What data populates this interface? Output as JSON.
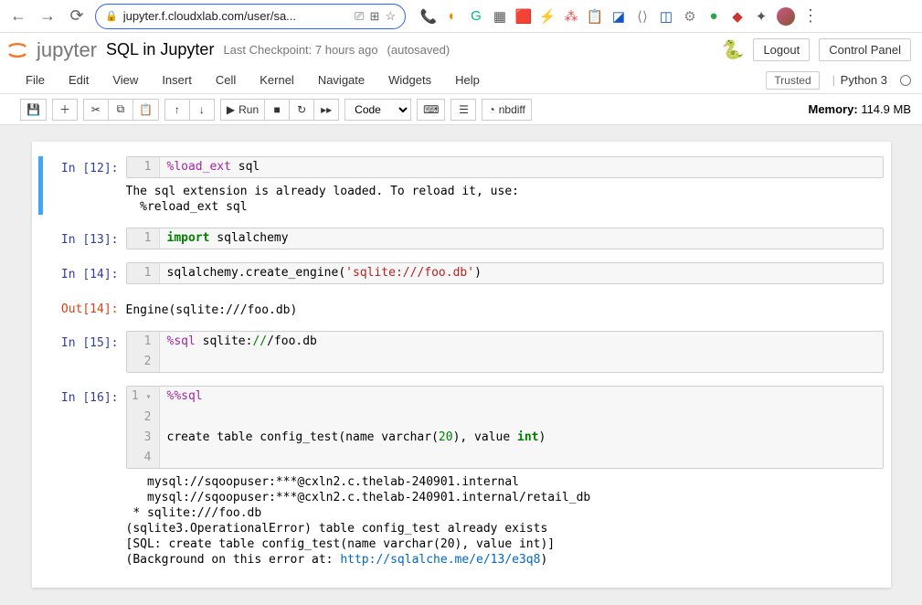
{
  "browser": {
    "url": "jupyter.f.cloudxlab.com/user/sa..."
  },
  "header": {
    "logo_text": "jupyter",
    "title": "SQL in Jupyter",
    "checkpoint": "Last Checkpoint: 7 hours ago",
    "autosaved": "(autosaved)",
    "logout": "Logout",
    "control_panel": "Control Panel"
  },
  "menu": {
    "items": [
      "File",
      "Edit",
      "View",
      "Insert",
      "Cell",
      "Kernel",
      "Navigate",
      "Widgets",
      "Help"
    ],
    "trusted": "Trusted",
    "kernel": "Python 3"
  },
  "toolbar": {
    "run": "Run",
    "cell_type": "Code",
    "nbdiff": "nbdiff",
    "memory_label": "Memory:",
    "memory_value": "114.9 MB"
  },
  "cells": [
    {
      "prompt": "In [12]:",
      "selected": true,
      "lines": [
        {
          "n": "1",
          "src_html": "<span class='c-magic'>%load_ext</span> sql"
        }
      ],
      "output": "The sql extension is already loaded. To reload it, use:\n  %reload_ext sql"
    },
    {
      "prompt": "In [13]:",
      "lines": [
        {
          "n": "1",
          "src_html": "<span class='c-kw'>import</span> sqlalchemy"
        }
      ]
    },
    {
      "prompt": "In [14]:",
      "lines": [
        {
          "n": "1",
          "src_html": "sqlalchemy.create_engine(<span class='c-str'>'sqlite:///foo.db'</span>)"
        }
      ],
      "out_prompt": "Out[14]:",
      "output": "Engine(sqlite:///foo.db)"
    },
    {
      "prompt": "In [15]:",
      "lines": [
        {
          "n": "1",
          "src_html": "<span class='c-magic'>%sql</span> sqlite:<span class='c-num'>//</span>/foo.db"
        },
        {
          "n": "2",
          "src_html": ""
        }
      ]
    },
    {
      "prompt": "In [16]:",
      "fold": true,
      "lines": [
        {
          "n": "1",
          "src_html": "<span class='c-magic'>%%sql</span>"
        },
        {
          "n": "2",
          "src_html": ""
        },
        {
          "n": "3",
          "src_html": "create table config_test(name varchar(<span class='c-num'>20</span>), value <span class='c-kw'>int</span>)"
        },
        {
          "n": "4",
          "src_html": ""
        }
      ],
      "output_html": "   mysql://sqoopuser:***@cxln2.c.thelab-240901.internal\n   mysql://sqoopuser:***@cxln2.c.thelab-240901.internal/retail_db\n * sqlite:///foo.db\n(sqlite3.OperationalError) table config_test already exists\n[SQL: create table config_test(name varchar(20), value int)]\n(Background on this error at: <span class='c-link'>http://sqlalche.me/e/13/e3q8</span>)"
    }
  ]
}
